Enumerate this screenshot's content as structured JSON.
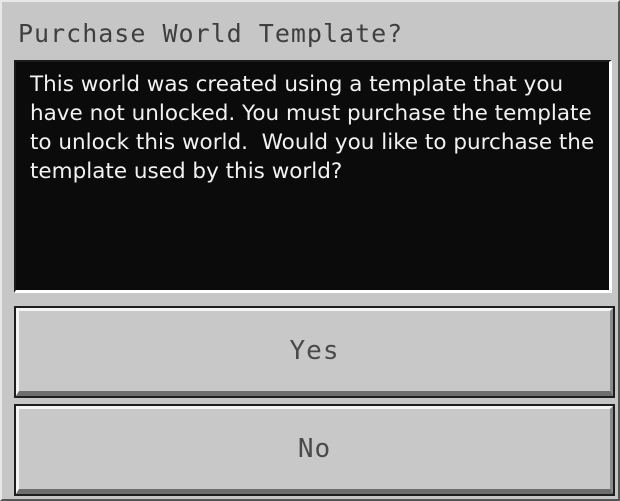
{
  "dialog": {
    "title": "Purchase World Template?",
    "message": "This world was created using a template that you have not unlocked. You must purchase the template to unlock this world.  Would you like to purchase the template used by this world?",
    "buttons": {
      "yes_label": "Yes",
      "no_label": "No"
    }
  }
}
